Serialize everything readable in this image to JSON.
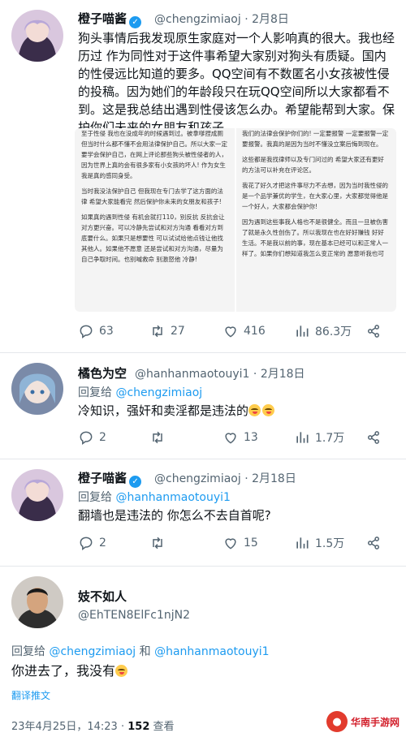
{
  "tweet1": {
    "display_name": "橙子喵酱",
    "handle": "@chengzimiaoj",
    "sep": "·",
    "date": "2月8日",
    "text": "狗头事情后我发现原生家庭对一个人影响真的很大。我也经历过 作为同性对于这件事希望大家别对狗头有质疑。国内的性侵远比知道的要多。QQ空间有不数匿名小女孩被性侵的投稿。因为她们的年龄段只在玩QQ空间所以大家都看不到。这是我总结出遇到性侵该怎么办。希望能帮到大家。保护你们未来的女朋友和孩子。",
    "embed_left": [
      "至于性侵 我也在没成年的时候遇到过。被拿嗲捏成厕 但当时什么都不懂不会用法律保护自己。所以大家一定要学会保护自己，在网上评论那些狗头被性侵者的人，因为世界上真的会有很多家有小女孩的坏人! 作为女生我是真的感同身受。",
      "当时我没法保护自己 但我现在专门去学了这方面的法律 希望大家能看完 然后保护你未来的女朋友和孩子!",
      "如果真的遇到性侵 有机会就打110，别反抗 反抗会让对方更兴奋。可以冷静先尝试和对方沟通 看看对方到底要什么。如果只是想要性 可以试试给他点钱让他找其他人。如果他不愿意 还是尝试和对方沟通，尽量为自己争取时间。也别喊救命 别激怒他 冷静!"
    ],
    "embed_right": [
      "我们的法律会保护你们的! 一定要报警 一定要报警一定要报警。我真的是因为当时不懂没立案后悔到现在。",
      "这些都是我找律师以及专门问过的 希望大家还有更好的方法可以补充在评论区。",
      "我花了好久才把这件事尽力不去想，因为当时我性侵的是一个品学兼优的学生，在大家心里，大家都觉得他是一个好人，大家都会保护你!",
      "因为遇到这些事我人格也不是很健全。而且一旦被伤害了就是永久性创伤了。所以我现在也在好好赚钱 好好生活。不是我以前的事，现在基本已经可以和正常人一样了。如果你们想知道我怎么变正常的 愿意听我也可"
    ],
    "replies": "63",
    "retweets": "27",
    "likes": "416",
    "views": "86.3万"
  },
  "tweet2": {
    "display_name": "橘色为空",
    "handle": "@hanhanmaotouyi1",
    "sep": "·",
    "date": "2月18日",
    "replying_prefix": "回复给",
    "replying_to": "@chengzimiaoj",
    "text": "冷知识，强奸和卖淫都是违法的",
    "replies": "2",
    "retweets": "",
    "likes": "13",
    "views": "1.7万"
  },
  "tweet3": {
    "display_name": "橙子喵酱",
    "handle": "@chengzimiaoj",
    "sep": "·",
    "date": "2月18日",
    "replying_prefix": "回复给",
    "replying_to": "@hanhanmaotouyi1",
    "text": "翻墙也是违法的 你怎么不去自首呢?",
    "replies": "2",
    "retweets": "",
    "likes": "15",
    "views": "1.5万"
  },
  "tweet4": {
    "display_name": "妓不如人",
    "handle": "@EhTEN8ElFc1njN2",
    "replying_prefix": "回复给",
    "replying_to_1": "@chengzimiaoj",
    "replying_and": "和",
    "replying_to_2": "@hanhanmaotouyi1",
    "text": "你进去了，我没有",
    "translate": "翻译推文",
    "timestamp": "23年4月25日，14:23",
    "dot": "·",
    "view_count": "152",
    "view_label": "查看"
  },
  "watermark": {
    "text": "华南手游网",
    "logo_glyph": "●"
  },
  "colors": {
    "accent": "#1d9bf0",
    "muted": "#536471",
    "text": "#0f1419"
  }
}
